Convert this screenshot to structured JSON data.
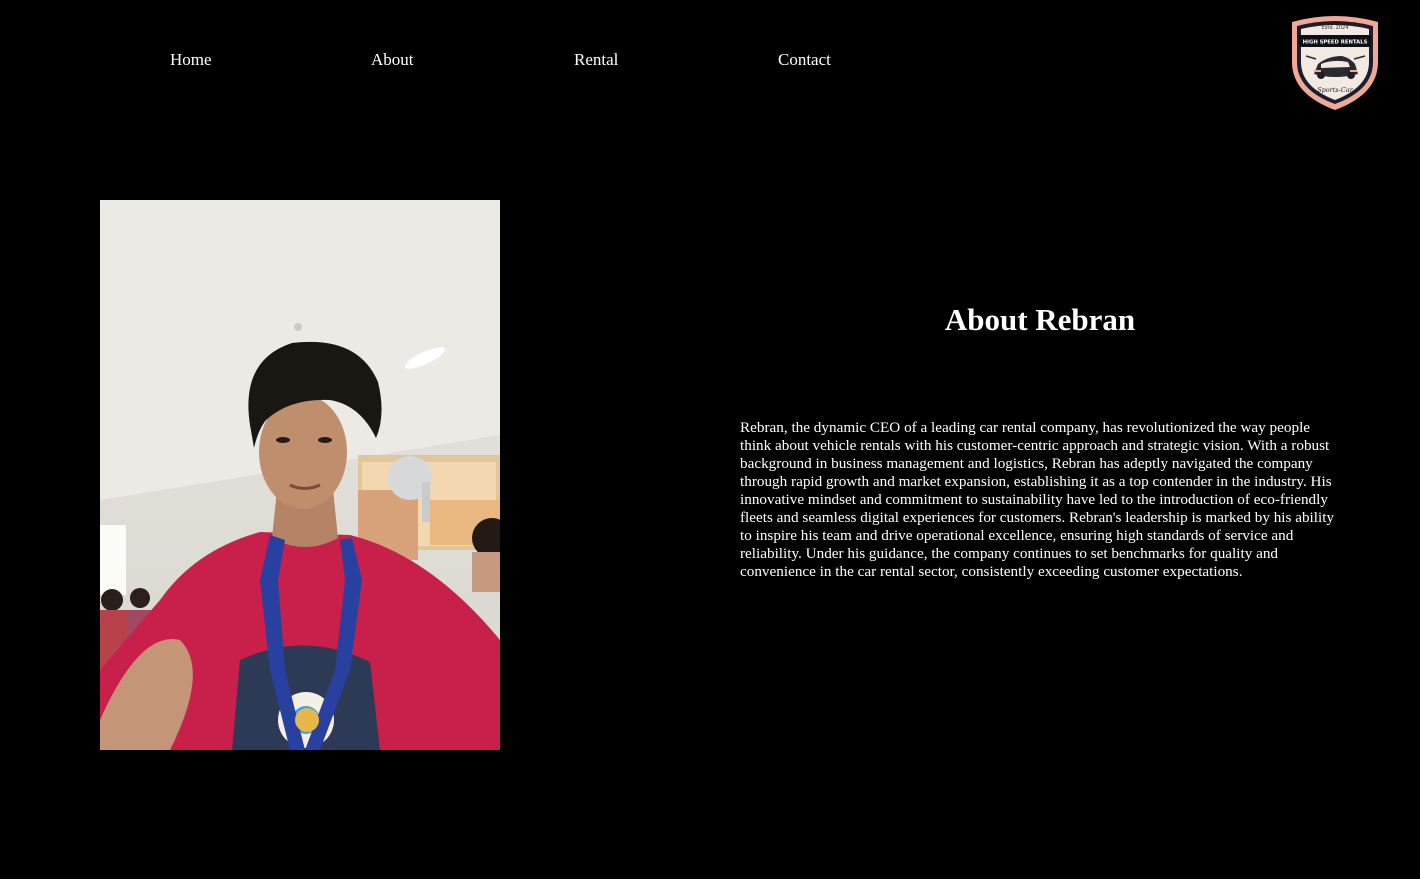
{
  "nav": {
    "items": [
      {
        "label": "Home"
      },
      {
        "label": "About"
      },
      {
        "label": "Rental"
      },
      {
        "label": "Contact"
      }
    ]
  },
  "logo": {
    "top_text": "Estd. 2024",
    "banner_text": "HIGH SPEED RENTALS",
    "bottom_text": "Sports-Car",
    "colors": {
      "outer": "#f0a898",
      "inner": "#1e1e2a",
      "banner": "#0e0e14"
    }
  },
  "about": {
    "title": "About Rebran",
    "bio": "Rebran, the dynamic CEO of a leading car rental company, has revolutionized the way people think about vehicle rentals with his customer-centric approach and strategic vision. With a robust background in business management and logistics, Rebran has adeptly navigated the company through rapid growth and market expansion, establishing it as a top contender in the industry. His innovative mindset and commitment to sustainability have led to the introduction of eco-friendly fleets and seamless digital experiences for customers. Rebran's leadership is marked by his ability to inspire his team and drive operational excellence, ensuring high standards of service and reliability. Under his guidance, the company continues to set benchmarks for quality and convenience in the car rental sector, consistently exceeding customer expectations."
  },
  "photo": {
    "subject": "portrait-photo",
    "colors": {
      "wall": "#e6e4df",
      "shirt": "#c8204a",
      "lanyard": "#2840a0",
      "hair": "#1a1612",
      "skin": "#b98a6a"
    }
  }
}
